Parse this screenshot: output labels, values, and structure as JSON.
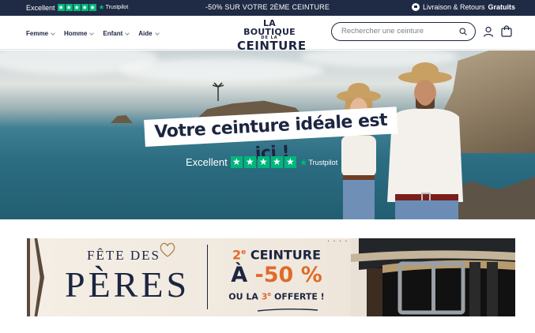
{
  "topbar": {
    "rating_label": "Excellent",
    "trustpilot": "Trustpilot",
    "promo": "-50% SUR VOTRE 2ÈME CEINTURE",
    "shipping_text": "Livraison & Retours",
    "shipping_bold": "Gratuits"
  },
  "header": {
    "logo_line1": "LA BOUTIQUE",
    "logo_line2": "DE LA",
    "logo_line3": "CEINTURE",
    "nav": [
      {
        "label": "Femme"
      },
      {
        "label": "Homme"
      },
      {
        "label": "Enfant"
      },
      {
        "label": "Aide"
      }
    ],
    "search_placeholder": "Rechercher une ceinture"
  },
  "hero": {
    "title": "Votre ceinture idéale est ici !",
    "rating_label": "Excellent",
    "trustpilot": "Trustpilot"
  },
  "banner": {
    "line_fete": "FÊTE DES",
    "line_peres": "PÈRES",
    "offer_num": "2",
    "offer_sup": "e",
    "offer_word": " CEINTURE",
    "offer_a": "À ",
    "offer_pct": "-50 %",
    "offer_ou": "OU LA ",
    "offer_3": "3",
    "offer_3sup": "e",
    "offer_end": " OFFERTE !"
  },
  "colors": {
    "navy": "#1f2a44",
    "trustpilot_green": "#00b67a",
    "accent_orange": "#e06b2b"
  }
}
